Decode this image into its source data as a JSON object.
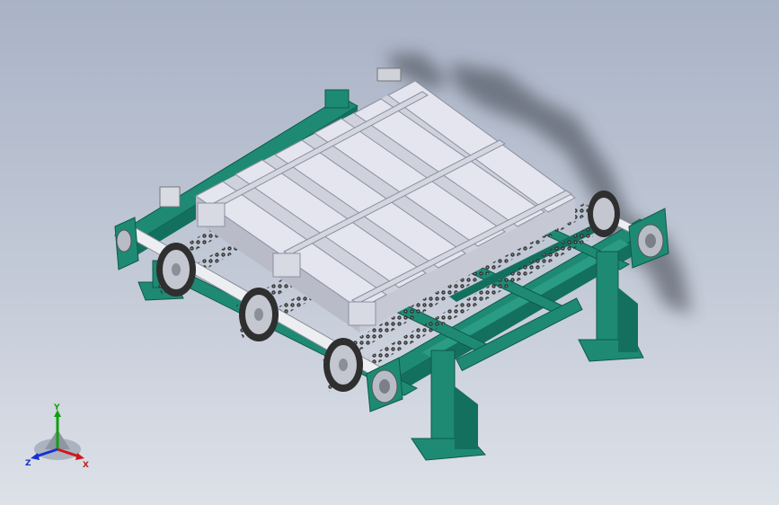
{
  "viewport": {
    "background_top": "#a9b3c6",
    "background_bottom": "#dde1e8"
  },
  "model": {
    "frame_color": "#1e8a74",
    "frame_dark": "#0f5a4a",
    "pallet_color": "#e4e5ee",
    "pallet_shadow": "#b9bbc8",
    "chain_color": "#3a3a3a",
    "shaft_color": "#eceef2",
    "sprocket_count": 3,
    "chain_strand_count": 3,
    "leg_count": 4
  },
  "triad": {
    "x_label": "X",
    "y_label": "Y",
    "z_label": "Z",
    "x_color": "#d01818",
    "y_color": "#10a010",
    "z_color": "#1830d0",
    "icon": "view-orientation-triad-icon"
  }
}
